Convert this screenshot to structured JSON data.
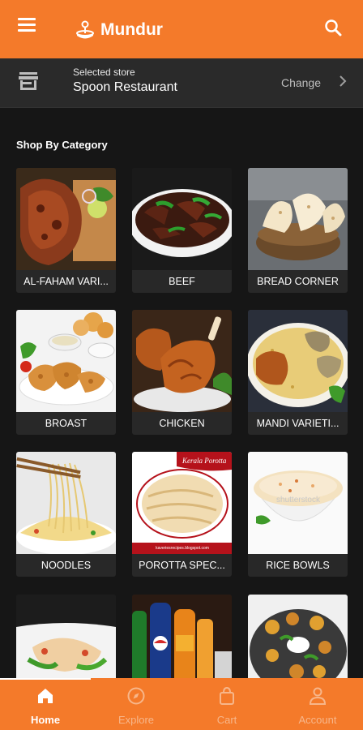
{
  "header": {
    "app_name": "Mundur",
    "menu_icon": "hamburger-icon",
    "search_icon": "search-icon",
    "logo_icon": "joystick-logo-icon"
  },
  "store": {
    "label": "Selected store",
    "name": "Spoon Restaurant",
    "change_label": "Change",
    "store_icon": "storefront-icon",
    "chevron_icon": "chevron-right-icon"
  },
  "section_title": "Shop By Category",
  "categories": [
    {
      "name": "AL-FAHAM VARI..."
    },
    {
      "name": "BEEF"
    },
    {
      "name": "BREAD CORNER"
    },
    {
      "name": "BROAST"
    },
    {
      "name": "CHICKEN"
    },
    {
      "name": "MANDI VARIETI..."
    },
    {
      "name": "NOODLES"
    },
    {
      "name": "POROTTA SPEC..."
    },
    {
      "name": "RICE BOWLS"
    },
    {
      "name": ""
    },
    {
      "name": ""
    },
    {
      "name": ""
    }
  ],
  "image_text": {
    "porotta_banner": "Kerala Porotta",
    "porotta_url": "kaveriesrecipes.blogspot.com",
    "rice_watermark": "shutterstock"
  },
  "nav": [
    {
      "label": "Home",
      "icon": "home-icon",
      "active": true
    },
    {
      "label": "Explore",
      "icon": "compass-icon",
      "active": false
    },
    {
      "label": "Cart",
      "icon": "shopping-bag-icon",
      "active": false
    },
    {
      "label": "Account",
      "icon": "user-icon",
      "active": false
    }
  ],
  "colors": {
    "brand": "#f47a2a",
    "background": "#161616",
    "card": "#282828",
    "store_bar": "#2a2a2a"
  }
}
